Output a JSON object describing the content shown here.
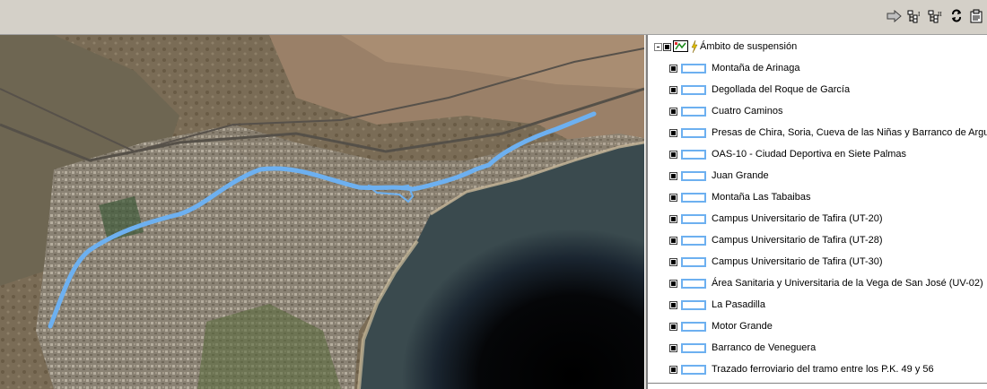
{
  "toolbar": {
    "icons": [
      "arrow-right-icon",
      "tree-view-1-icon",
      "tree-view-2-icon",
      "sync-icon",
      "properties-icon"
    ]
  },
  "map": {
    "route_color": "#6db0f0"
  },
  "legend": {
    "group": {
      "label": "Ámbito de suspensión",
      "checked": false
    },
    "layers": [
      {
        "label": "Montaña de Arinaga"
      },
      {
        "label": "Degollada del Roque de García"
      },
      {
        "label": "Cuatro Caminos"
      },
      {
        "label": "Presas de Chira, Soria, Cueva de las Niñas y Barranco de Arguineguín"
      },
      {
        "label": "OAS-10 - Ciudad Deportiva en Siete Palmas"
      },
      {
        "label": "Juan Grande"
      },
      {
        "label": "Montaña Las Tabaibas"
      },
      {
        "label": "Campus Universitario de Tafira (UT-20)"
      },
      {
        "label": "Campus Universitario de Tafira (UT-28)"
      },
      {
        "label": "Campus Universitario de Tafira (UT-30)"
      },
      {
        "label": "Área Sanitaria y Universitaria de la Vega de San José (UV-02)"
      },
      {
        "label": "La Pasadilla"
      },
      {
        "label": "Motor Grande"
      },
      {
        "label": "Barranco de Veneguera"
      },
      {
        "label": "Trazado ferroviario del tramo entre los P.K. 49 y 56"
      }
    ],
    "swatch_color": "#6db0f0"
  }
}
